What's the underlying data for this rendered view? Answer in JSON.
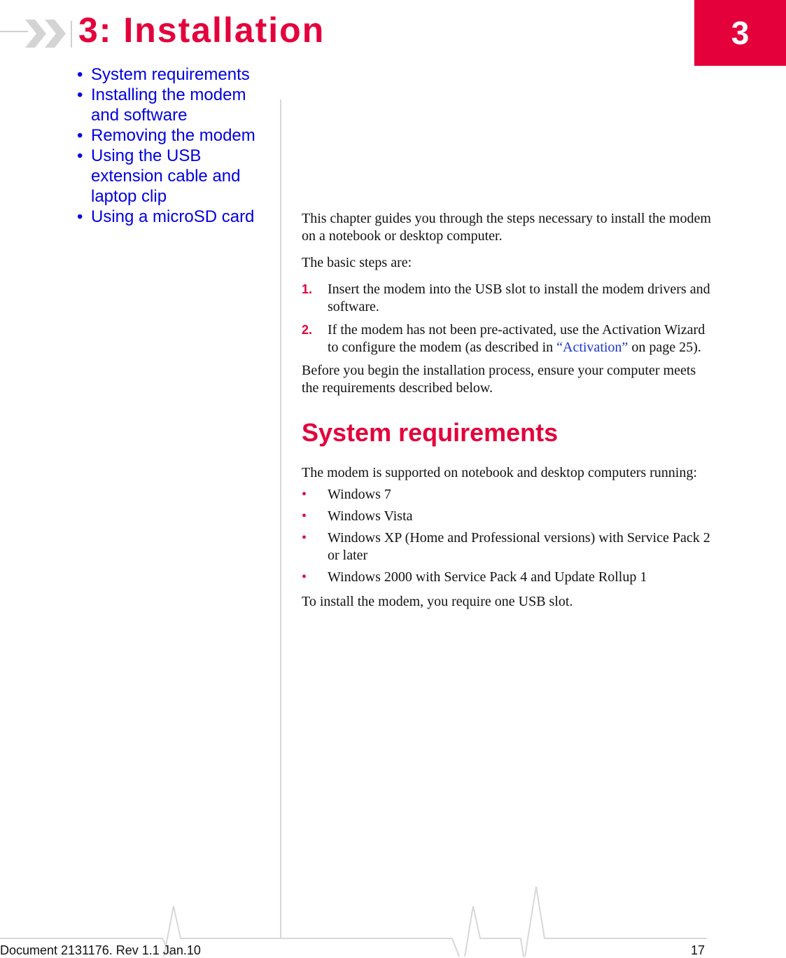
{
  "chapter": {
    "title": "3: Installation",
    "tab_number": "3"
  },
  "toc": [
    {
      "bullet": "•",
      "label": "System requirements"
    },
    {
      "bullet": "•",
      "label": "Installing the modem and software"
    },
    {
      "bullet": "•",
      "label": "Removing the modem"
    },
    {
      "bullet": "•",
      "label": "Using the USB extension cable and laptop clip"
    },
    {
      "bullet": "•",
      "label": "Using a microSD card"
    }
  ],
  "body": {
    "intro": "This chapter guides you through the steps necessary to install the modem on a notebook or desktop computer.",
    "steps_intro": "The basic steps are:",
    "steps": [
      {
        "num": "1.",
        "text": "Insert the modem into the USB slot to install the modem drivers and software."
      },
      {
        "num": "2.",
        "text_before": "If the modem has not been pre-activated, use the Activation Wizard to configure the modem (as described in ",
        "link": "“Activation”",
        "text_after": " on page 25)."
      }
    ],
    "before_begin": "Before you begin the installation process, ensure your computer meets the requirements described below.",
    "section_heading": "System requirements",
    "supported_intro": "The modem is supported on notebook and desktop computers running:",
    "os_list": [
      "Windows 7",
      "Windows Vista",
      "Windows XP (Home and Professional versions) with Service Pack 2 or later",
      "Windows 2000 with Service Pack 4 and Update Rollup 1"
    ],
    "closing": "To install the modem, you require one USB slot."
  },
  "footer": {
    "doc_info": "Document 2131176. Rev 1.1  Jan.10",
    "page_number": "17"
  },
  "colors": {
    "brand_red": "#e4003b",
    "link_blue": "#0000e0",
    "rule_gray": "#d8d8d8"
  }
}
